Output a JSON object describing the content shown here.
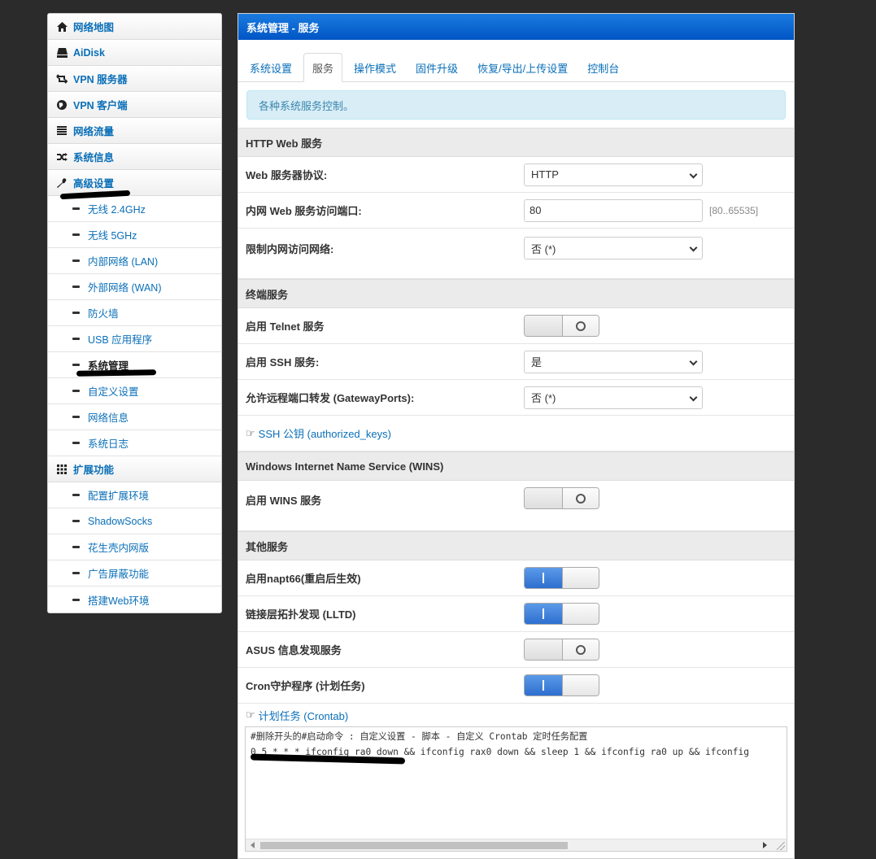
{
  "sidebar": {
    "items": [
      {
        "label": "网络地图",
        "icon": "home-icon"
      },
      {
        "label": "AiDisk",
        "icon": "disk-icon"
      },
      {
        "label": "VPN 服务器",
        "icon": "retweet-icon"
      },
      {
        "label": "VPN 客户端",
        "icon": "globe-icon"
      },
      {
        "label": "网络流量",
        "icon": "list-icon"
      },
      {
        "label": "系统信息",
        "icon": "shuffle-icon"
      },
      {
        "label": "高级设置",
        "icon": "wrench-icon"
      }
    ],
    "advanced_sub": [
      "无线 2.4GHz",
      "无线 5GHz",
      "内部网络 (LAN)",
      "外部网络 (WAN)",
      "防火墙",
      "USB 应用程序",
      "系统管理",
      "自定义设置",
      "网络信息",
      "系统日志"
    ],
    "ext_label": "扩展功能",
    "ext_sub": [
      "配置扩展环境",
      "ShadowSocks",
      "花生壳内网版",
      "广告屏蔽功能",
      "搭建Web环境"
    ]
  },
  "main": {
    "title": "系统管理 - 服务",
    "tabs": [
      "系统设置",
      "服务",
      "操作模式",
      "固件升级",
      "恢复/导出/上传设置",
      "控制台"
    ],
    "info": "各种系统服务控制。",
    "http": {
      "title": "HTTP Web 服务",
      "protocol_label": "Web 服务器协议:",
      "protocol_value": "HTTP",
      "port_label": "内网 Web 服务访问端口:",
      "port_value": "80",
      "port_hint": "[80..65535]",
      "restrict_label": "限制内网访问网络:",
      "restrict_value": "否 (*)"
    },
    "terminal": {
      "title": "终端服务",
      "telnet_label": "启用 Telnet 服务",
      "ssh_label": "启用 SSH 服务:",
      "ssh_value": "是",
      "gateway_label": "允许远程端口转发 (GatewayPorts):",
      "gateway_value": "否 (*)",
      "ssh_key_link": "SSH 公钥 (authorized_keys)"
    },
    "wins": {
      "title": "Windows Internet Name Service (WINS)",
      "enable_label": "启用 WINS 服务"
    },
    "other": {
      "title": "其他服务",
      "napt66_label": "启用napt66(重启后生效)",
      "lltd_label": "链接层拓扑发现 (LLTD)",
      "asus_label": "ASUS 信息发现服务",
      "cron_label": "Cron守护程序 (计划任务)",
      "crontab_link": "计划任务 (Crontab)",
      "crontab_lines": [
        "#删除开头的#启动命令 : 自定义设置 - 脚本 - 自定义 Crontab 定时任务配置",
        "0 5 * * * ifconfig ra0 down && ifconfig rax0 down && sleep 1 && ifconfig ra0 up && ifconfig"
      ]
    }
  }
}
